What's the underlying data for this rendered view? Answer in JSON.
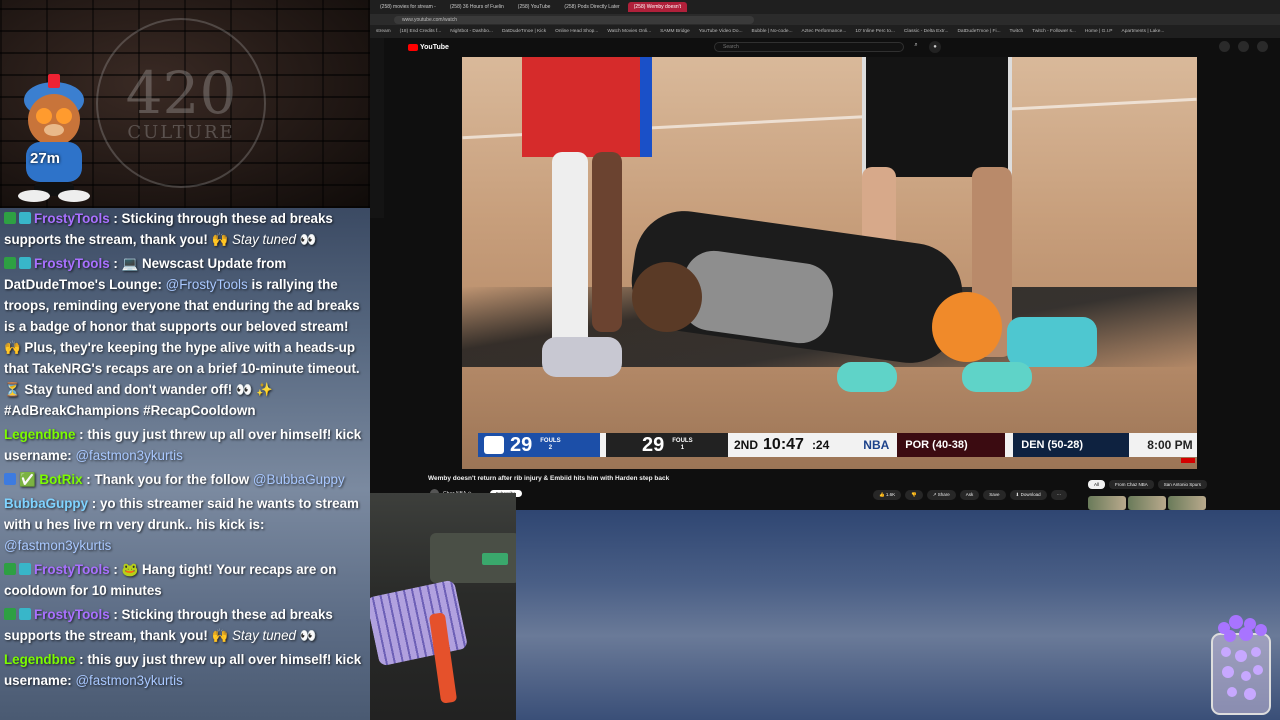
{
  "overlay": {
    "logo_big": "420",
    "logo_small": "CULTURE",
    "mascot_timer": "27m"
  },
  "chat": [
    {
      "badges": [
        "green",
        "teal"
      ],
      "user": "FrostyTools",
      "user_color": "#a970ff",
      "text": ": Sticking through these ad breaks supports the stream, thank you! 🙌 ",
      "em": "Stay tuned",
      "tail": " 👀"
    },
    {
      "badges": [
        "green",
        "teal"
      ],
      "user": "FrostyTools",
      "user_color": "#a970ff",
      "text": ": 💻 Newscast Update from DatDudeTmoe's Lounge: ",
      "mention": "@FrostyTools",
      "text2": " is rallying the troops, reminding everyone that enduring the ad breaks is a badge of honor that supports our beloved stream! 🙌 Plus, they're keeping the hype alive with a heads-up that TakeNRG's recaps are on a brief 10-minute timeout. ⏳ Stay tuned and don't wander off! 👀 ✨ #AdBreakChampions #RecapCooldown"
    },
    {
      "badges": [],
      "user": "Legendbne",
      "user_color": "#7cfc00",
      "text": ": this guy just threw up all over himself! kick username: ",
      "mention": "@fastmon3ykurtis",
      "text2": ""
    },
    {
      "badges": [
        "blue"
      ],
      "user": "✅ BotRix",
      "user_color": "#7cfc00",
      "text": ": Thank you for the follow ",
      "mention": "@BubbaGuppy",
      "text2": ""
    },
    {
      "badges": [],
      "user": "BubbaGuppy",
      "user_color": "#7fd3ff",
      "text": ": yo this streamer said he wants to stream with u hes live rn very drunk.. his kick is: ",
      "mention": "@fastmon3ykurtis",
      "text2": ""
    },
    {
      "badges": [
        "green",
        "teal"
      ],
      "user": "FrostyTools",
      "user_color": "#a970ff",
      "text": ": 🐸 Hang tight! Your recaps are on cooldown for 10 minutes",
      "mention": "",
      "text2": ""
    },
    {
      "badges": [
        "green",
        "teal"
      ],
      "user": "FrostyTools",
      "user_color": "#a970ff",
      "text": ": Sticking through these ad breaks supports the stream, thank you! 🙌 ",
      "em": "Stay tuned",
      "tail": " 👀"
    },
    {
      "badges": [],
      "user": "Legendbne",
      "user_color": "#7cfc00",
      "text": ": this guy just threw up all over himself! kick username: ",
      "mention": "@fastmon3ykurtis",
      "text2": ""
    }
  ],
  "browser": {
    "tabs": [
      "(258) movies for stream -",
      "(258) 36 Hours of Fuelin",
      "(258) YouTube",
      "(258) Pods Directly Later",
      "(258) Wemby doesn't"
    ],
    "active_tab": 4,
    "url": "www.youtube.com/watch",
    "bookmarks": [
      "stream",
      "(18) End Credits f...",
      "Nightbot - Dashbo...",
      "DatDudeTmoe | Kick",
      "Online Head Shop...",
      "Watch Movies Onli...",
      "SAMM Bridge",
      "YouTube Video Do...",
      "Bubble | No-code...",
      "Aztec Performance...",
      "10' Inline Perc to...",
      "Classic - Delta Extr...",
      "DatDudeTmoe | Fi...",
      "Twitch",
      "Twitch - Follower s...",
      "Home | G.I.P",
      "Apartments | Lake..."
    ]
  },
  "youtube": {
    "logo": "YouTube",
    "search_placeholder": "Search",
    "video_title": "Wemby doesn't return after rib injury & Embiid hits him with Harden step back",
    "channel": "Chaz NBA ⊙",
    "subscribe": "Subscribe",
    "actions": [
      "👍 1.6K",
      "👎",
      "↗ Share",
      "Ask",
      "Save",
      "⬇ Download",
      "⋯"
    ],
    "chips": [
      "All",
      "From Chaz NBA",
      "San Antonio Spurs"
    ]
  },
  "scoreboard": {
    "phi_score": "29",
    "phi_fouls_label": "FOULS",
    "phi_fouls": "2",
    "sas_score": "29",
    "sas_fouls_label": "FOULS",
    "sas_fouls": "1",
    "period": "2ND",
    "clock": "10:47",
    "shot_clock": ":24",
    "league": "NBA",
    "game1": "POR (40-38)",
    "game2": "DEN (50-28)",
    "tip_time": "8:00 PM"
  },
  "colors": {
    "chat_purple": "#a970ff",
    "chat_green": "#7cfc00",
    "yt_red": "#ff0000",
    "phi_blue": "#1c4fa8"
  }
}
